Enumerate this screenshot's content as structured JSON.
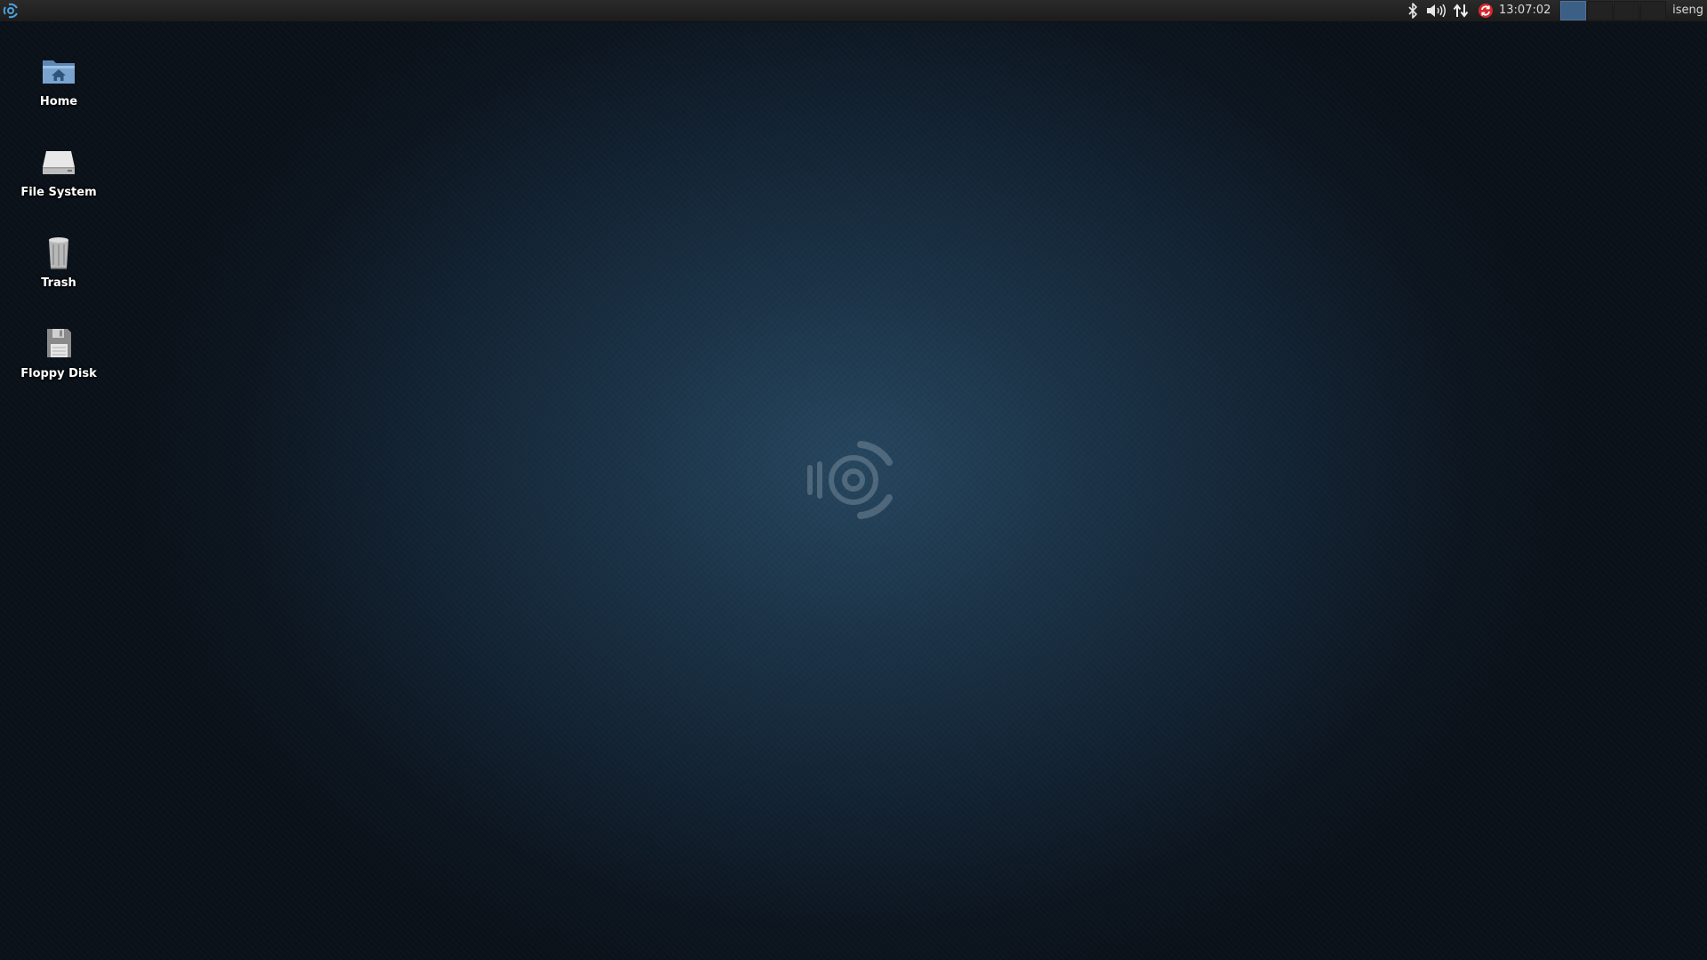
{
  "panel": {
    "menu_icon": "whisker-menu-icon",
    "tray_icons": [
      "bluetooth-icon",
      "volume-icon",
      "network-icon",
      "update-notifier-icon"
    ],
    "clock": "13:07:02",
    "workspaces": {
      "count": 4,
      "active": 1
    },
    "user": "iseng"
  },
  "desktop": {
    "icons": [
      {
        "label": "Home",
        "icon": "home-folder-icon"
      },
      {
        "label": "File System",
        "icon": "drive-icon"
      },
      {
        "label": "Trash",
        "icon": "trash-icon"
      },
      {
        "label": "Floppy Disk",
        "icon": "floppy-icon"
      }
    ],
    "wallpaper_logo": "ubuntu-studio-logo",
    "colors": {
      "wallpaper_center": "#26465f",
      "wallpaper_edge": "#0a1119",
      "panel": "#1f1f1f",
      "workspace_active": "#3c5f86"
    }
  }
}
